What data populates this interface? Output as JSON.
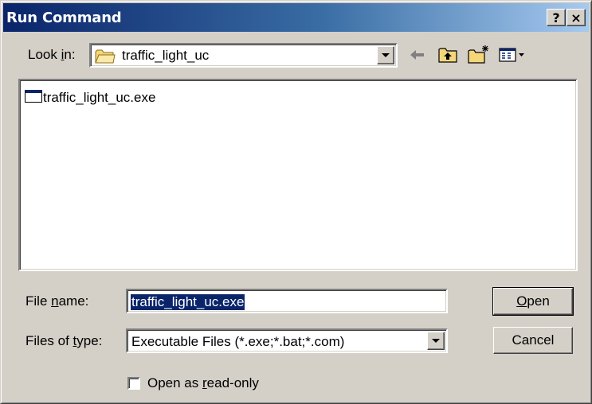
{
  "window": {
    "title": "Run Command",
    "help_glyph": "?",
    "close_glyph": "×"
  },
  "look_in": {
    "label_pre": "Look ",
    "label_ul": "i",
    "label_post": "n:",
    "value": "traffic_light_uc"
  },
  "toolbar": {
    "icons": [
      "back-arrow-icon",
      "up-folder-icon",
      "new-folder-icon",
      "view-menu-icon"
    ]
  },
  "files": [
    {
      "name": "traffic_light_uc.exe",
      "icon": "exe-icon"
    }
  ],
  "file_name": {
    "label_pre": "File ",
    "label_ul": "n",
    "label_post": "ame:",
    "value": "traffic_light_uc.exe"
  },
  "files_of_type": {
    "label_pre": "Files of ",
    "label_ul": "t",
    "label_post": "ype:",
    "value": "Executable Files (*.exe;*.bat;*.com)"
  },
  "buttons": {
    "open_ul": "O",
    "open_rest": "pen",
    "cancel": "Cancel"
  },
  "readonly_checkbox": {
    "label_pre": "Open as ",
    "label_ul": "r",
    "label_post": "ead-only",
    "checked": false
  },
  "colors": {
    "title_start": "#0a246a",
    "title_end": "#a6caf0",
    "face": "#d4d0c8",
    "selection": "#0a246a"
  }
}
